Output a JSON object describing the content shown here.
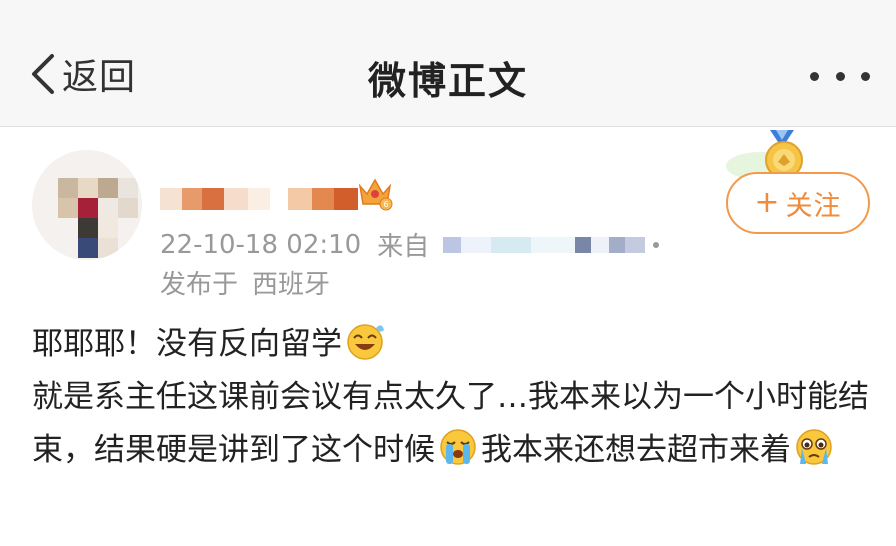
{
  "nav": {
    "back_label": "返回",
    "title": "微博正文",
    "more_icon": "more-dots-icon"
  },
  "author": {
    "post_time": "22-10-18 02:10",
    "source_prefix": "来自",
    "location_prefix": "发布于",
    "location": "西班牙",
    "follow_label": "关注",
    "follow_plus": "+"
  },
  "post": {
    "segments": [
      "耶耶耶！没有反向留学",
      "就是系主任这课前会议有点太久了…我本来以为一个小时能结束，结果硬是讲到了这个时候",
      "我本来还想去超市来着"
    ]
  },
  "colors": {
    "accent": "#f08a3c",
    "meta_text": "#999999",
    "nav_bg": "#f7f7f7"
  }
}
